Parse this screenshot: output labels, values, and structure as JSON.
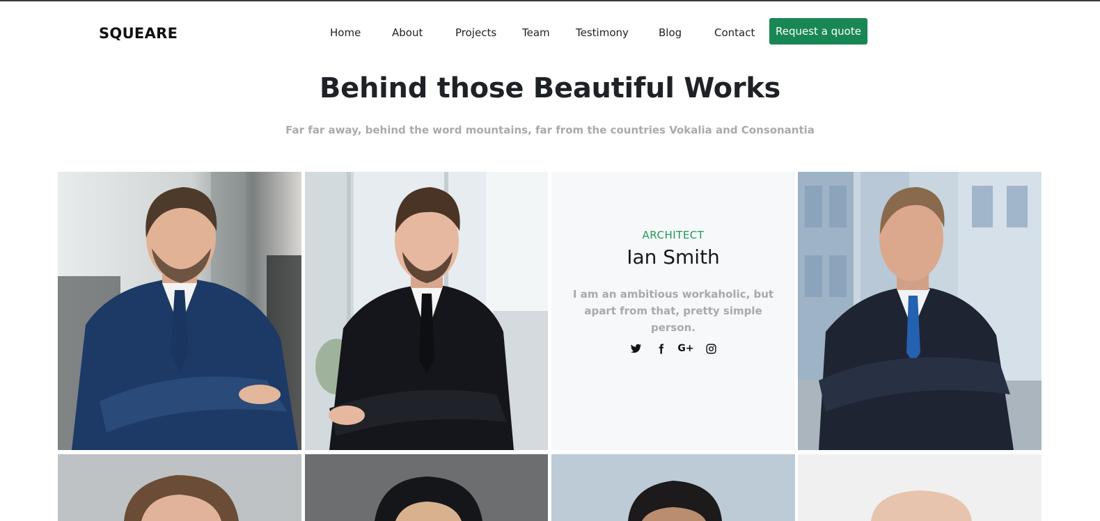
{
  "brand": {
    "logo": "SQUEARE"
  },
  "nav": {
    "items": [
      {
        "label": "Home"
      },
      {
        "label": "About"
      },
      {
        "label": "Projects"
      },
      {
        "label": "Team"
      },
      {
        "label": "Testimony"
      },
      {
        "label": "Blog"
      },
      {
        "label": "Contact"
      }
    ],
    "cta_label": "Request a quote"
  },
  "section": {
    "title": "Behind those Beautiful Works",
    "subtitle": "Far far away, behind the word mountains, far from the countries Vokalia and Consonantia"
  },
  "featured_member": {
    "role": "ARCHITECT",
    "name": "Ian Smith",
    "bio": "I am an ambitious workaholic, but apart from that, pretty simple person.",
    "socials": [
      "twitter-icon",
      "facebook-icon",
      "google-plus-icon",
      "instagram-icon"
    ],
    "google_plus_glyph": "G+"
  },
  "colors": {
    "accent": "#198754",
    "role_text": "#1d9a56",
    "muted_text": "#aaaaaa",
    "info_bg": "#f6f8fa"
  }
}
